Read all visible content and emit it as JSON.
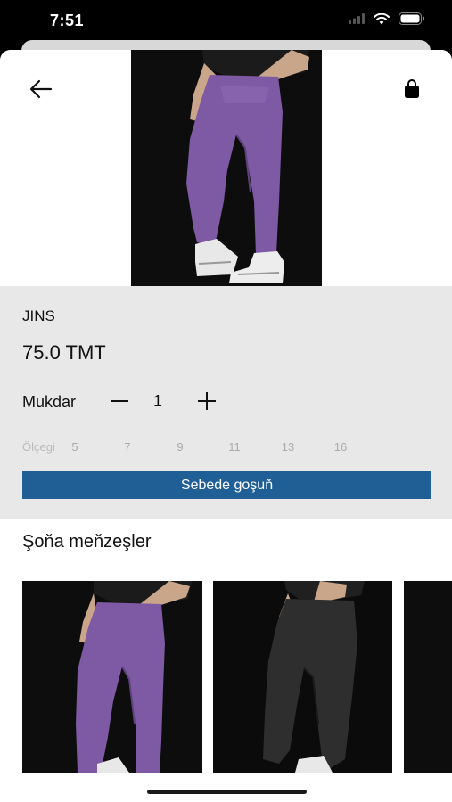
{
  "status_bar": {
    "time": "7:51",
    "icons": [
      "signal-icon",
      "wifi-icon",
      "battery-icon"
    ]
  },
  "header": {
    "back_icon": "arrow-left-icon",
    "cart_icon": "shopping-bag-icon"
  },
  "product": {
    "name": "JINS",
    "price": "75.0 TMT",
    "photo": "purple-jeans-photo",
    "quantity_label": "Mukdar",
    "quantity": "1",
    "size_label": "Ölçegi",
    "sizes": [
      "5",
      "7",
      "9",
      "11",
      "13",
      "16"
    ],
    "add_to_cart_label": "Sebede goşuň",
    "accent_color": "#1f5f96"
  },
  "similar": {
    "title": "Şoňa meňzeşler",
    "items": [
      {
        "photo": "purple-jeans-photo"
      },
      {
        "photo": "black-jeans-photo"
      },
      {
        "photo": "dark-photo"
      }
    ]
  }
}
